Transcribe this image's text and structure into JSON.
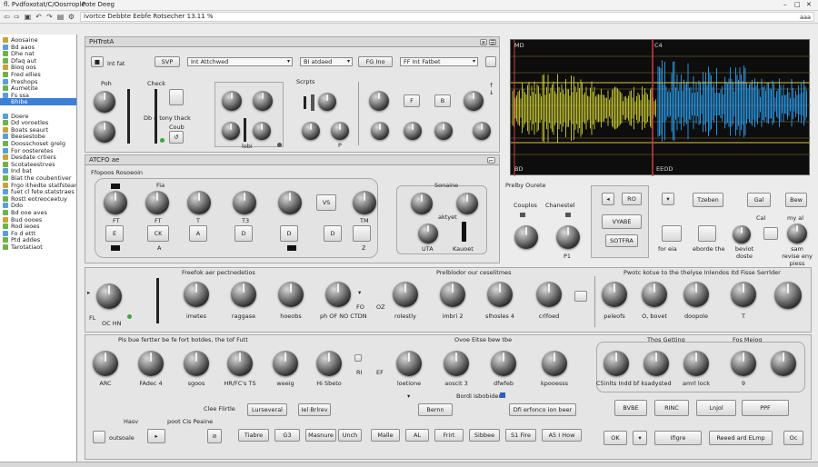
{
  "window": {
    "title": "fl. Pvdfoxotat/C/Oosrrople",
    "tab": "Pote Deeg"
  },
  "address": {
    "value": "ivortce Debbte Eebfe Rotsecher 13.11 %",
    "menu": "aaa"
  },
  "sidebar": {
    "items": [
      {
        "label": "Aoosaine",
        "color": "#c8a33a"
      },
      {
        "label": "Bd aaos",
        "color": "#5aa0d8"
      },
      {
        "label": "Dhe nat",
        "color": "#6fb24a"
      },
      {
        "label": "Dfaq aut",
        "color": "#6fb24a"
      },
      {
        "label": "Bioq oos",
        "color": "#c8a33a"
      },
      {
        "label": "Fred ellies",
        "color": "#6fb24a"
      },
      {
        "label": "Preshops",
        "color": "#5aa0d8"
      },
      {
        "label": "Aumetite",
        "color": "#6fb24a"
      },
      {
        "label": "Fs ssa",
        "color": "#5aa0d8"
      },
      {
        "label": "Bhibe",
        "color": "#3b7fd6",
        "selected": true
      },
      {
        "label": "",
        "color": "#ffffff"
      },
      {
        "label": "Doere",
        "color": "#5aa0d8"
      },
      {
        "label": "Dd voroetles",
        "color": "#6fb24a"
      },
      {
        "label": "Boats seaurt",
        "color": "#c8a33a"
      },
      {
        "label": "Beesestobe",
        "color": "#5aa0d8"
      },
      {
        "label": "Doosschoset grelg",
        "color": "#6fb24a"
      },
      {
        "label": "For oosteretes",
        "color": "#5aa0d8"
      },
      {
        "label": "Desdate crtiers",
        "color": "#c8a33a"
      },
      {
        "label": "Scotateestrves",
        "color": "#6fb24a"
      },
      {
        "label": "Ind bat",
        "color": "#5aa0d8"
      },
      {
        "label": "Biat the coubentiver",
        "color": "#6fb24a"
      },
      {
        "label": "Frgo ithedte statfsteart",
        "color": "#c8a33a"
      },
      {
        "label": "fuet cl fete.statstraes",
        "color": "#5aa0d8"
      },
      {
        "label": "Rostt eotreoceetuy",
        "color": "#6fb24a"
      },
      {
        "label": "Ddo",
        "color": "#5aa0d8"
      },
      {
        "label": "Bd ooe aves",
        "color": "#6fb24a"
      },
      {
        "label": "Bud oooes",
        "color": "#c8a33a"
      },
      {
        "label": "Rod ieoes",
        "color": "#6fb24a"
      },
      {
        "label": "Fo d ettt",
        "color": "#5aa0d8"
      },
      {
        "label": "Ptd addes",
        "color": "#6fb24a"
      },
      {
        "label": "Tarotatiaot",
        "color": "#6fb24a"
      }
    ]
  },
  "top_panel": {
    "title": "PHTrotA",
    "stop": "Int fat",
    "btn1": "SVP",
    "dd1": "Int Attchwed",
    "dd2": "BI atdaed",
    "btn2": "FG Ino",
    "dd3": "FF Int Fatbet",
    "lbl_pch": "Poh",
    "lbl_check": "Check",
    "lbl_stat": "Db o tony thack",
    "lbl_coub": "Coub",
    "lbl_scrpts": "Scrpts",
    "lbl_lobi": "lobi",
    "lbl_p": "P",
    "btn_f": "F",
    "btn_b": "B"
  },
  "wave": {
    "top_left": "MD",
    "top_right": "C4",
    "bottom_left": "BD",
    "bottom_right": "EEOD"
  },
  "mid_panel": {
    "title": "ATCFO ae",
    "sub": "Ffopoos Rosoeoin",
    "lbl_fia": "Fia",
    "knob_labels": [
      "FT",
      "FT",
      "T",
      "T3",
      "",
      "TM"
    ],
    "btns": [
      "E",
      "CK",
      "A",
      "D",
      "D",
      "D"
    ],
    "vs": "VS",
    "lbl_a": "A",
    "lbl_z": "Z",
    "lbl_sonaine": "Sonaine",
    "lbl_aktyet": "aktyet",
    "lbl_uta": "UTA",
    "lbl_kauon": "Kauoet"
  },
  "right_panel": {
    "title": "Prelby Ourete",
    "couples": "Couplos",
    "chanestel": "Chanestel",
    "p1": "P1",
    "b_ro": "RO",
    "b_vyabe": "VYABE",
    "b_sotfra": "SOTFRA",
    "b_tzeben": "Tzeben",
    "b_gal": "Gal",
    "b_bew": "Bew",
    "b_cal": "Cal",
    "b_myal": "my al",
    "lbl_ferzio": "for eia",
    "lbl_eborde": "eborde the",
    "lbl_devote": "beviot doste",
    "lbl_sam": "sam revise eny piess"
  },
  "strip1": {
    "title_left": "Freefok aer pectnedetios",
    "title_mid": "Prelblodor our ceselitmes",
    "title_right": "Pwotc kotue to the thelyse Inlendos Itd Fisse Serrlder",
    "fl": "FL",
    "ocin": "OC HN",
    "fo": "FO",
    "oz": "OZ",
    "knob_labels": [
      "imetes",
      "raggase",
      "hoeobs",
      "ph OF NO CTDN",
      "rolestly",
      "imbri 2",
      "slhosles 4",
      "crlfoed",
      "peleofs",
      "O, bovet",
      "doopole",
      "T"
    ]
  },
  "strip2": {
    "title_left": "Pis bue fertter be fe fort botdes, the tof Futt",
    "title_mid": "Ovoe Eitse bew tbe",
    "title_right_a": "Thos Getting",
    "title_right_b": "Fos Meiog",
    "knob_labels": [
      "ARC",
      "FAdec 4",
      "sgoos",
      "HR/FC's TS",
      "weeig",
      "Hi Sbeto",
      "loetione",
      "aoscit 3",
      "dfwfeb",
      "kpooesss",
      "C5inlts Indd bf",
      "ksadysted",
      "amrl lock",
      "9"
    ],
    "ri": "RI",
    "ef": "EF",
    "cle_fliatle": "Clee Flirtle",
    "boon": "Bordi isbobider",
    "h_fow": "Hasv",
    "pot_fns": "poot Cis Peaine",
    "outeale": "outsoale",
    "buttons1": [
      "Lurseveral",
      "Iel Brlrev",
      "Bernn",
      "Dfi erfonco ion beer"
    ],
    "buttons2": [
      "Tiabre",
      "G3",
      "Masnure",
      "Unch",
      "Malle",
      "AL",
      "Frirt",
      "Sibbee",
      "S1 Fire",
      "A5 I How"
    ],
    "rbtn": [
      "BVBE",
      "RINC",
      "Lnjol",
      "PPF",
      "OK",
      "Ifigre",
      "Reeed ard ELmp",
      "Oc"
    ]
  }
}
